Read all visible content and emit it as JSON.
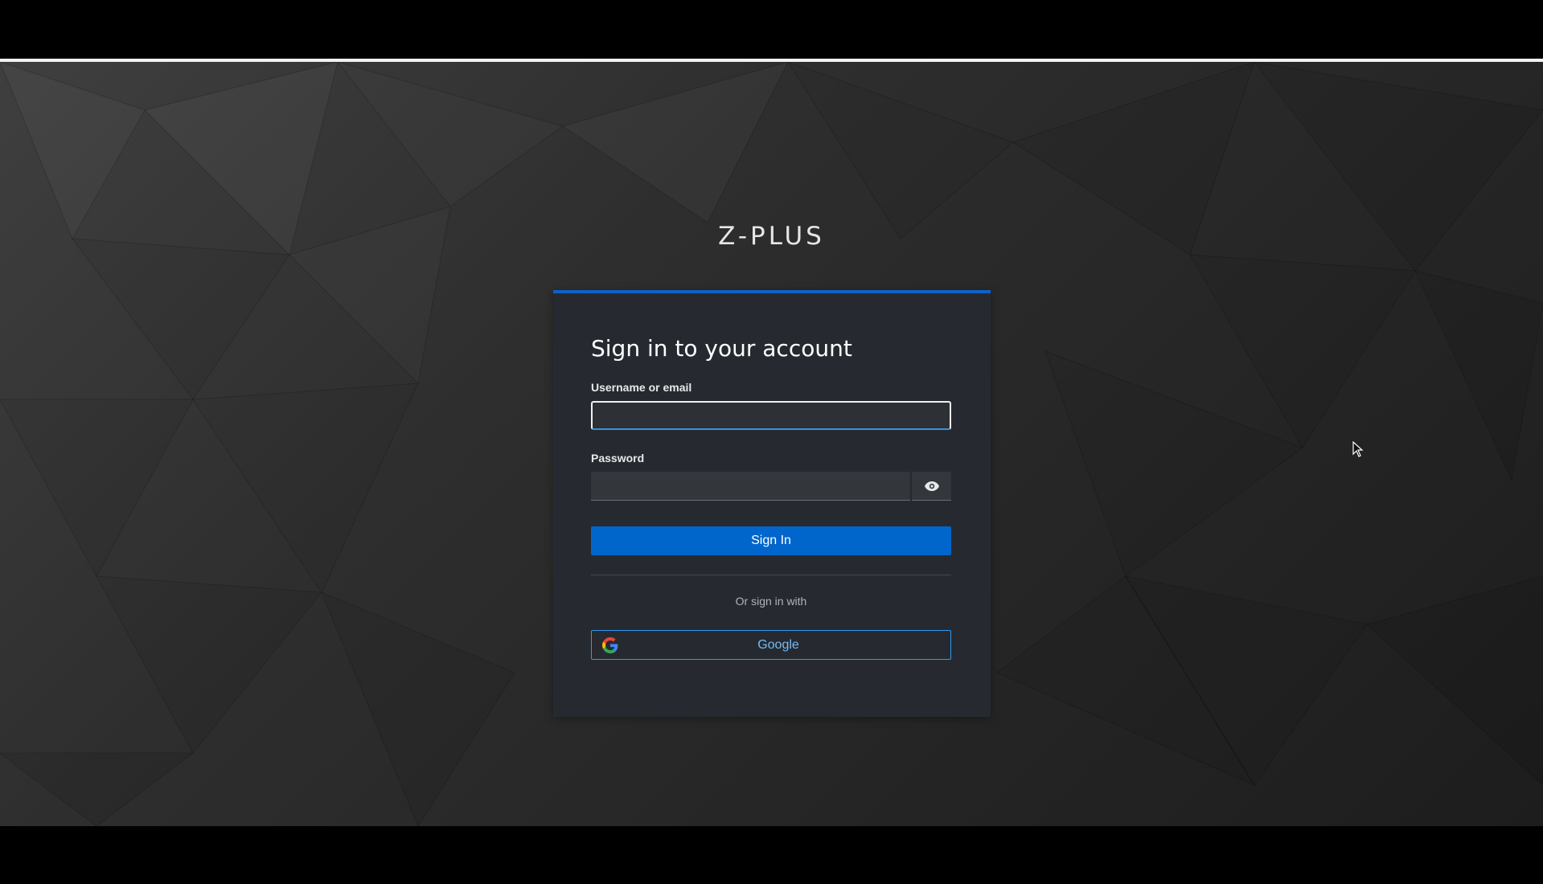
{
  "brand": {
    "name": "Z-PLUS"
  },
  "login": {
    "title": "Sign in to your account",
    "username_label": "Username or email",
    "username_value": "",
    "password_label": "Password",
    "password_value": "",
    "show_password_icon": "eye-icon",
    "submit_label": "Sign In",
    "alt_signin_text": "Or sign in with",
    "providers": [
      {
        "name": "Google",
        "icon": "google-icon"
      }
    ]
  },
  "colors": {
    "accent": "#0066cc",
    "card_top_border": "#0e62c9",
    "card_background": "#262a30",
    "provider_border": "#2b9af3",
    "provider_text": "#73bcf7"
  }
}
